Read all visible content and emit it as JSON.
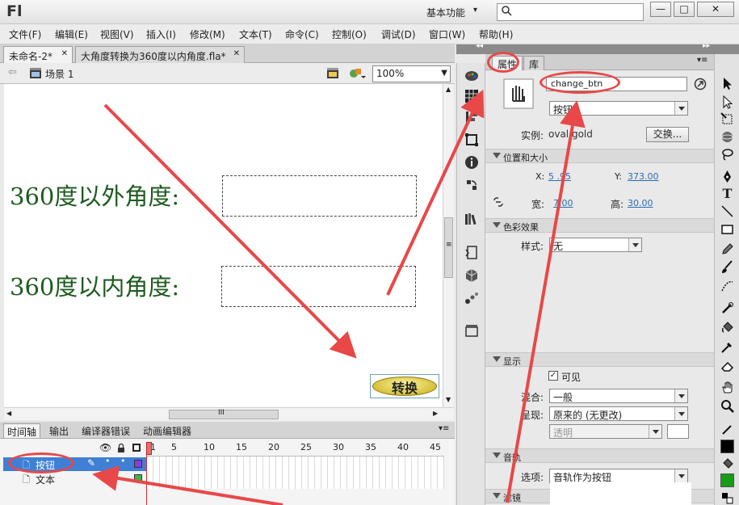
{
  "app": {
    "logo": "Fl",
    "workspace": "基本功能",
    "search_placeholder": "",
    "window_controls": {
      "minimize": "—",
      "maximize": "□",
      "close": "✕"
    }
  },
  "menu": [
    "文件(F)",
    "编辑(E)",
    "视图(V)",
    "插入(I)",
    "修改(M)",
    "文本(T)",
    "命令(C)",
    "控制(O)",
    "调试(D)",
    "窗口(W)",
    "帮助(H)"
  ],
  "doc_tabs": [
    {
      "label": "未命名-2*",
      "close": "✕"
    },
    {
      "label": "大角度转换为360度以内角度.fla*",
      "close": "✕"
    }
  ],
  "edit_bar": {
    "scene": "场景 1",
    "zoom": "100%"
  },
  "stage": {
    "label_outer": "360度以外角度:",
    "label_inner": "360度以内角度:",
    "button_label": "转换",
    "hscroll_grip": "III",
    "vscroll_grip": "≡"
  },
  "timeline": {
    "tabs": [
      "时间轴",
      "输出",
      "编译器错误",
      "动画编辑器"
    ],
    "frame_numbers": [
      "1",
      "5",
      "10",
      "15",
      "20",
      "25",
      "30",
      "35",
      "40",
      "45"
    ],
    "layers": [
      {
        "name": "按钮",
        "selected": true
      },
      {
        "name": "文本",
        "selected": false
      }
    ]
  },
  "properties": {
    "tabs": [
      "属性",
      "库"
    ],
    "instance_name": "change_btn",
    "symbol_type": "按钮",
    "instance_label": "实例:",
    "instance_value": "oval gold",
    "swap_button": "交换...",
    "sections": {
      "position_size": "位置和大小",
      "color_effect": "色彩效果",
      "display": "显示",
      "tracks": "音轨",
      "filters": "滤镜"
    },
    "x_label": "X:",
    "x_value": "5 .95",
    "y_label": "Y:",
    "y_value": "373.00",
    "w_label": "宽:",
    "w_value": "7.00",
    "h_label": "高:",
    "h_value": "30.00",
    "style_label": "样式:",
    "style_value": "无",
    "visible_label": "可见",
    "blend_label": "混合:",
    "blend_value": "一般",
    "render_label": "呈现:",
    "render_value": "原来的 (无更改)",
    "transparent_value": "透明",
    "option_label": "选项:",
    "option_value": "音轨作为按钮"
  },
  "colors": {
    "annotation_red": "#e84848",
    "stage_text": "#1e5b20",
    "selected_layer": "#3f7fd6",
    "button_gold": "#e8d35a"
  }
}
